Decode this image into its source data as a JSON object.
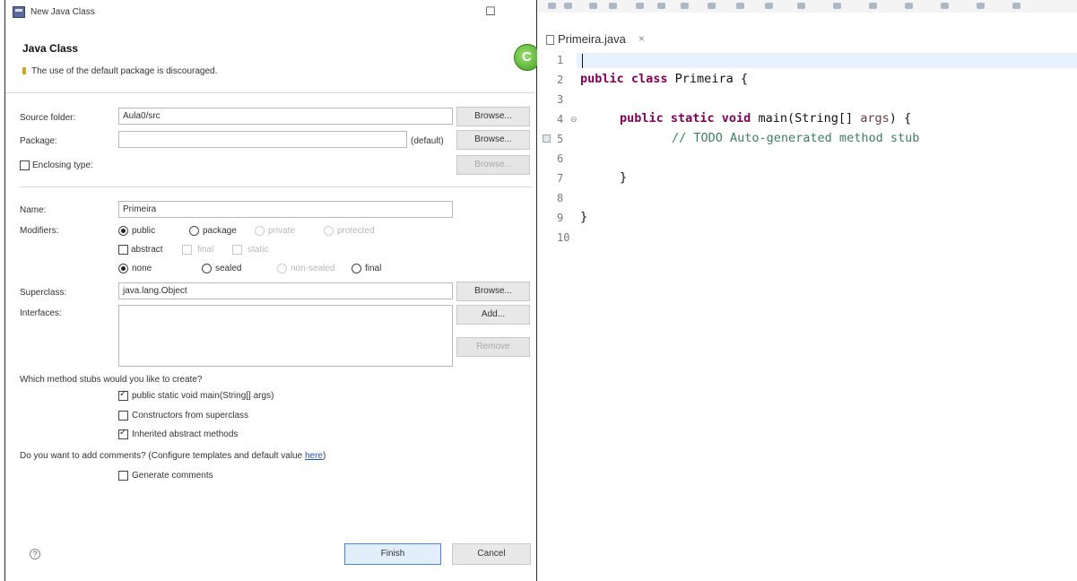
{
  "dialog": {
    "title": "New Java Class",
    "maximize_glyph": "☐",
    "heading": "Java Class",
    "warning": "The use of the default package is discouraged.",
    "source_folder": {
      "label": "Source folder:",
      "value": "Aula0/src",
      "browse": "Browse..."
    },
    "package": {
      "label": "Package:",
      "value": "",
      "hint": "(default)",
      "browse": "Browse..."
    },
    "enclosing_type": {
      "label": "Enclosing type:",
      "checked": false,
      "browse": "Browse..."
    },
    "name": {
      "label": "Name:",
      "value": "Primeira"
    },
    "modifiers": {
      "label": "Modifiers:",
      "access": [
        {
          "label": "public",
          "selected": true,
          "enabled": true
        },
        {
          "label": "package",
          "selected": false,
          "enabled": true
        },
        {
          "label": "private",
          "selected": false,
          "enabled": false
        },
        {
          "label": "protected",
          "selected": false,
          "enabled": false
        }
      ],
      "flags": [
        {
          "label": "abstract",
          "checked": false,
          "enabled": true
        },
        {
          "label": "final",
          "checked": false,
          "enabled": false
        },
        {
          "label": "static",
          "checked": false,
          "enabled": false
        }
      ],
      "sealing": [
        {
          "label": "none",
          "selected": true,
          "enabled": true
        },
        {
          "label": "sealed",
          "selected": false,
          "enabled": true
        },
        {
          "label": "non-sealed",
          "selected": false,
          "enabled": false
        },
        {
          "label": "final",
          "selected": false,
          "enabled": true
        }
      ]
    },
    "superclass": {
      "label": "Superclass:",
      "value": "java.lang.Object",
      "browse": "Browse..."
    },
    "interfaces": {
      "label": "Interfaces:",
      "add": "Add...",
      "remove": "Remove"
    },
    "stubs": {
      "question": "Which method stubs would you like to create?",
      "options": [
        {
          "label": "public static void main(String[] args)",
          "checked": true
        },
        {
          "label": "Constructors from superclass",
          "checked": false
        },
        {
          "label": "Inherited abstract methods",
          "checked": true
        }
      ]
    },
    "comments": {
      "question": "Do you want to add comments? (Configure templates and default value ",
      "link": "here",
      "question_end": ")",
      "option": "Generate comments",
      "checked": false
    },
    "help_glyph": "?",
    "finish": "Finish",
    "cancel": "Cancel"
  },
  "editor": {
    "tab_label": "Primeira.java",
    "tab_close": "×",
    "fold_glyph": "⊖",
    "line_numbers": [
      "1",
      "2",
      "3",
      "4",
      "5",
      "6",
      "7",
      "8",
      "9",
      "10"
    ],
    "code": {
      "l2_kw": "public class",
      "l2_rest": " Primeira {",
      "l4_kw": "public static void",
      "l4_rest": " main(String[] ",
      "l4_param": "args",
      "l4_end": ") {",
      "l5_comment": "// TODO Auto-generated method stub",
      "l7": "}",
      "l9": "}"
    }
  }
}
